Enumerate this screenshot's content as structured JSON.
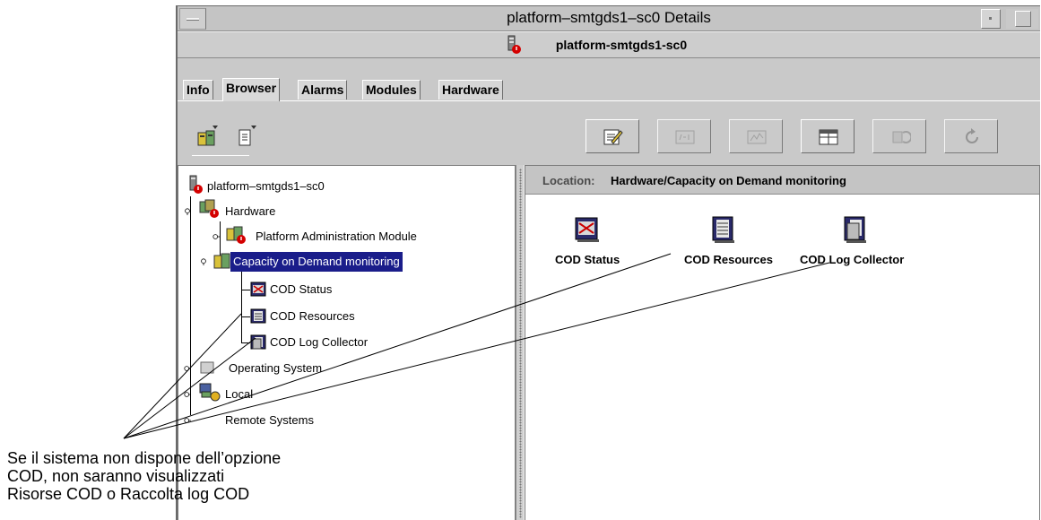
{
  "window": {
    "title": "platform–smtgds1–sc0 Details",
    "host": "platform-smtgds1-sc0"
  },
  "tabs": [
    "Info",
    "Browser",
    "Alarms",
    "Modules",
    "Hardware"
  ],
  "tree": {
    "root": "platform–smtgds1–sc0",
    "hardware": "Hardware",
    "pam": "Platform Administration Module",
    "cod_monitoring": "Capacity on Demand monitoring",
    "cod_status": "COD Status",
    "cod_resources": "COD Resources",
    "cod_log": "COD Log Collector",
    "operating_system": "Operating System",
    "local_apps": "Local ",
    "remote_systems": "Remote Systems"
  },
  "location": {
    "label": "Location:",
    "value": "Hardware/Capacity on Demand monitoring"
  },
  "right_items": [
    "COD Status",
    "COD Resources",
    "COD Log Collector"
  ],
  "callout": {
    "line1": "Se il sistema non dispone dell’opzione",
    "line2": "COD, non saranno visualizzati",
    "line3": "Risorse COD o Raccolta log COD"
  },
  "colors": {
    "window_bg": "#c9c9c9",
    "selection": "#1a1d8a",
    "alarm_red": "#d40000"
  }
}
